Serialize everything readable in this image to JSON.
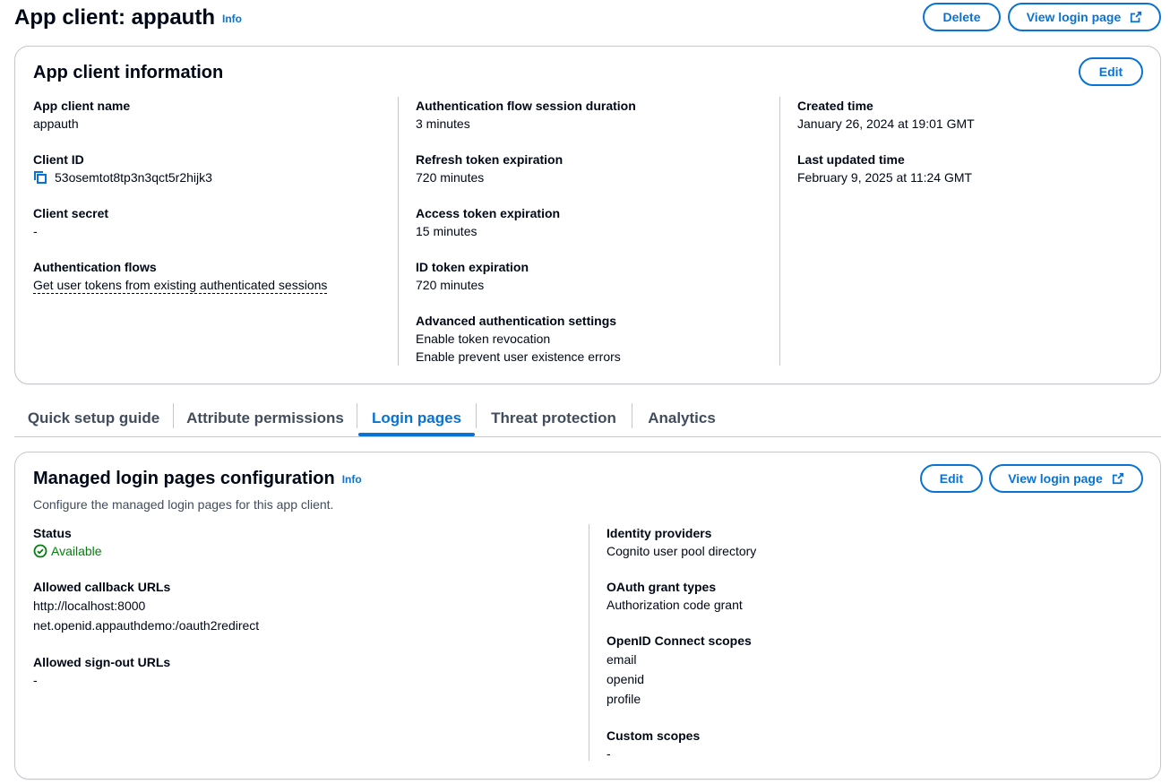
{
  "header": {
    "title": "App client: appauth",
    "info": "Info",
    "delete_label": "Delete",
    "view_login_label": "View login page"
  },
  "client_info": {
    "title": "App client information",
    "edit_label": "Edit",
    "col1": {
      "app_client_name_label": "App client name",
      "app_client_name": "appauth",
      "client_id_label": "Client ID",
      "client_id": "53osemtot8tp3n3qct5r2hijk3",
      "client_secret_label": "Client secret",
      "client_secret": "-",
      "auth_flows_label": "Authentication flows",
      "auth_flows": "Get user tokens from existing authenticated sessions"
    },
    "col2": {
      "session_duration_label": "Authentication flow session duration",
      "session_duration": "3 minutes",
      "refresh_label": "Refresh token expiration",
      "refresh": "720 minutes",
      "access_label": "Access token expiration",
      "access": "15 minutes",
      "id_label": "ID token expiration",
      "id": "720 minutes",
      "advanced_label": "Advanced authentication settings",
      "advanced": [
        "Enable token revocation",
        "Enable prevent user existence errors"
      ]
    },
    "col3": {
      "created_label": "Created time",
      "created": "January 26, 2024 at 19:01 GMT",
      "updated_label": "Last updated time",
      "updated": "February 9, 2025 at 11:24 GMT"
    }
  },
  "tabs": [
    {
      "label": "Quick setup guide",
      "active": false
    },
    {
      "label": "Attribute permissions",
      "active": false
    },
    {
      "label": "Login pages",
      "active": true
    },
    {
      "label": "Threat protection",
      "active": false
    },
    {
      "label": "Analytics",
      "active": false
    }
  ],
  "managed": {
    "title": "Managed login pages configuration",
    "info": "Info",
    "description": "Configure the managed login pages for this app client.",
    "edit_label": "Edit",
    "view_login_label": "View login page",
    "left": {
      "status_label": "Status",
      "status": "Available",
      "callback_label": "Allowed callback URLs",
      "callbacks": [
        "http://localhost:8000",
        "net.openid.appauthdemo:/oauth2redirect"
      ],
      "signout_label": "Allowed sign-out URLs",
      "signout": "-"
    },
    "right": {
      "idp_label": "Identity providers",
      "idp": "Cognito user pool directory",
      "grant_label": "OAuth grant types",
      "grant": "Authorization code grant",
      "scopes_label": "OpenID Connect scopes",
      "scopes": [
        "email",
        "openid",
        "profile"
      ],
      "custom_label": "Custom scopes",
      "custom": "-"
    }
  },
  "colors": {
    "accent": "#0972d3",
    "success": "#037f0c",
    "border": "#c6c6cd"
  }
}
